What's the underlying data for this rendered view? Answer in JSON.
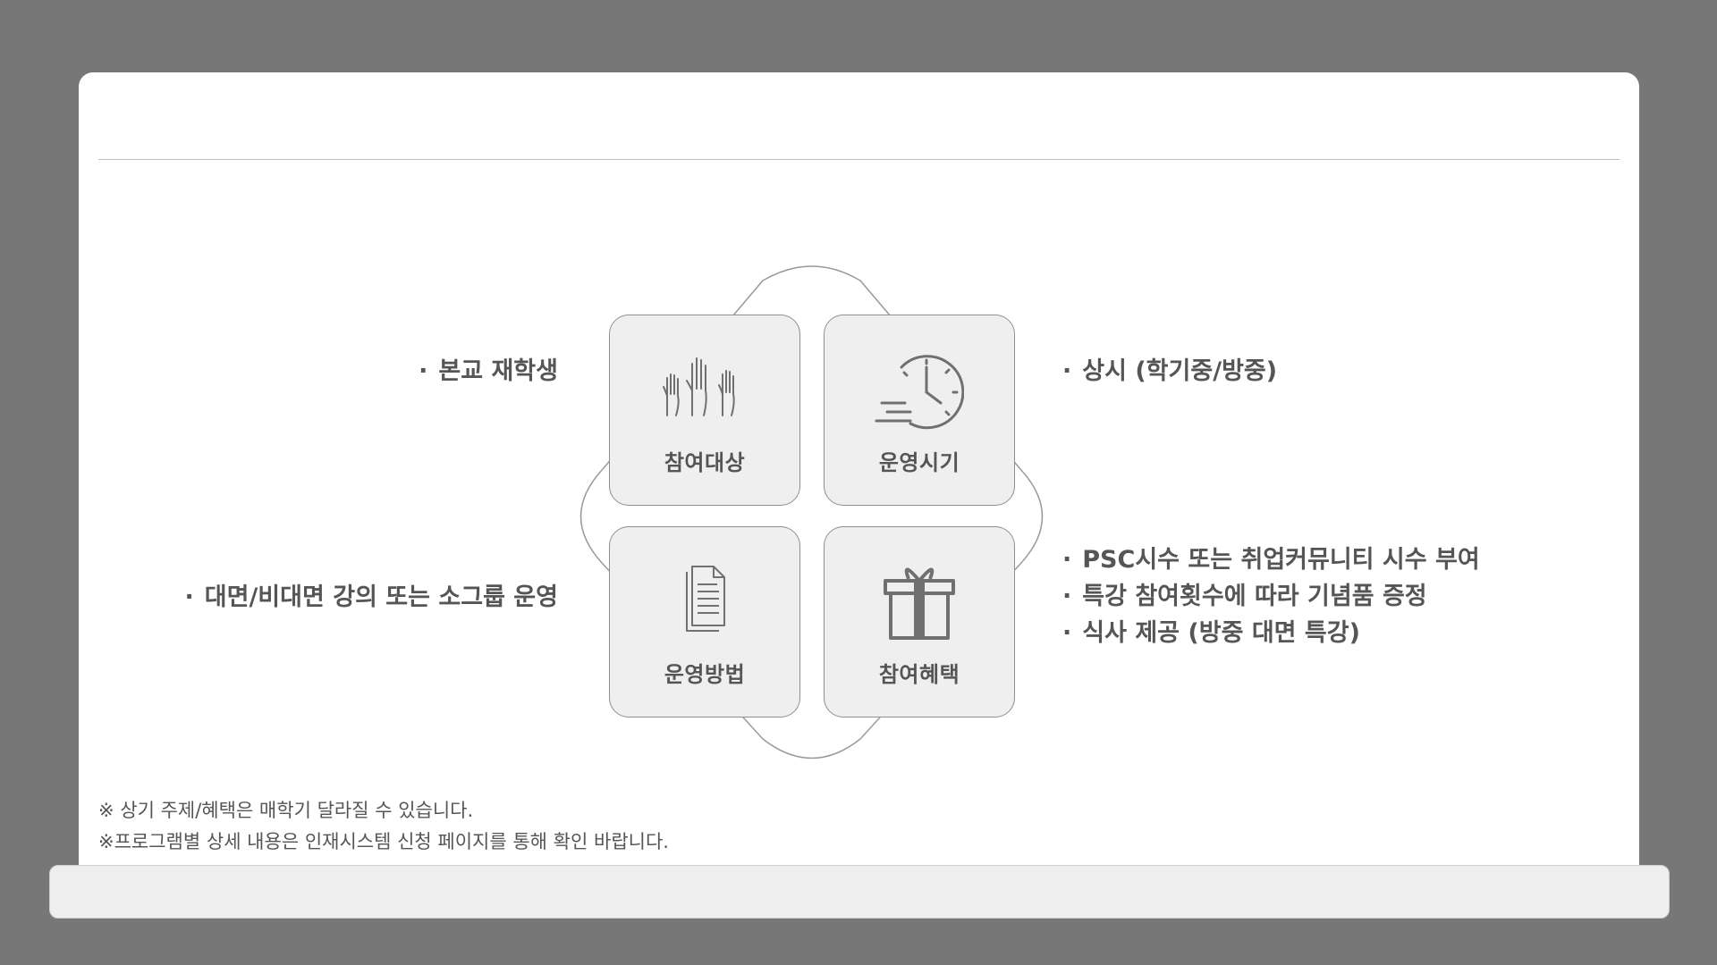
{
  "tiles": [
    {
      "label": "참여대상",
      "icon": "raised-hands-icon"
    },
    {
      "label": "운영시기",
      "icon": "clock-icon"
    },
    {
      "label": "운영방법",
      "icon": "document-icon"
    },
    {
      "label": "참여혜택",
      "icon": "gift-icon"
    }
  ],
  "bullet": "·",
  "info": {
    "target": [
      "본교 재학생"
    ],
    "period": [
      "상시 (학기중/방중)"
    ],
    "method": [
      "대면/비대면 강의 또는 소그룹 운영"
    ],
    "benefits": [
      "PSC시수 또는 취업커뮤니티 시수 부여",
      "특강 참여횟수에 따라 기념품 증정",
      "식사 제공 (방중 대면 특강)"
    ]
  },
  "notes": [
    "※ 상기 주제/혜택은 매학기 달라질 수 있습니다.",
    "※프로그램별 상세 내용은 인재시스템 신청 페이지를 통해 확인 바랍니다."
  ],
  "colors": {
    "background": "#777777",
    "card": "#ffffff",
    "tile": "#efefef",
    "text": "#555555"
  }
}
